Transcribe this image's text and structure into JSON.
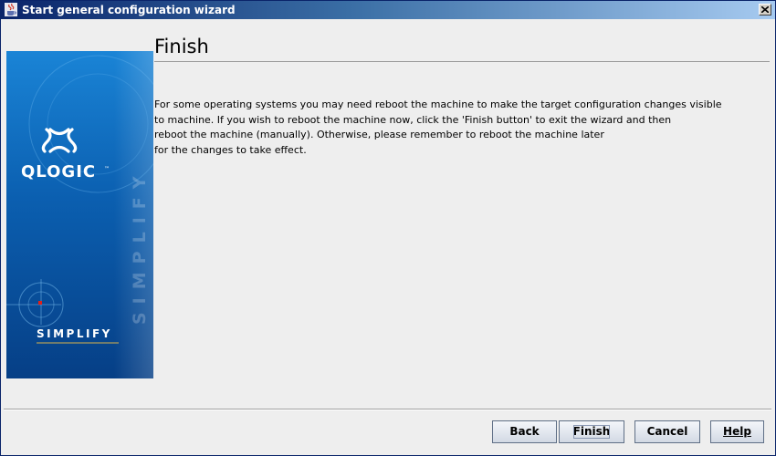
{
  "window": {
    "title": "Start general configuration wizard"
  },
  "header": {
    "title": "Finish"
  },
  "body": {
    "lines": [
      "For some operating systems you may need reboot the machine to make the target configuration changes visible",
      "to machine. If you wish to reboot the machine now, click the 'Finish button' to exit the wizard and then",
      "reboot the machine (manually).  Otherwise, please remember to reboot the machine later",
      "for the changes to take effect."
    ]
  },
  "brand": {
    "logo_text": "QLOGIC",
    "tagline": "SIMPLIFY",
    "watermark_text": "SIMPLIFY"
  },
  "buttons": {
    "back": "Back",
    "finish": "Finish",
    "cancel": "Cancel",
    "help": "Help"
  },
  "colors": {
    "titlebar_start": "#0a246a",
    "titlebar_end": "#a6caf0",
    "brand_blue": "#0a5fb4",
    "brand_accent_red": "#e0201a",
    "tagline_underline": "#d8b24a"
  }
}
